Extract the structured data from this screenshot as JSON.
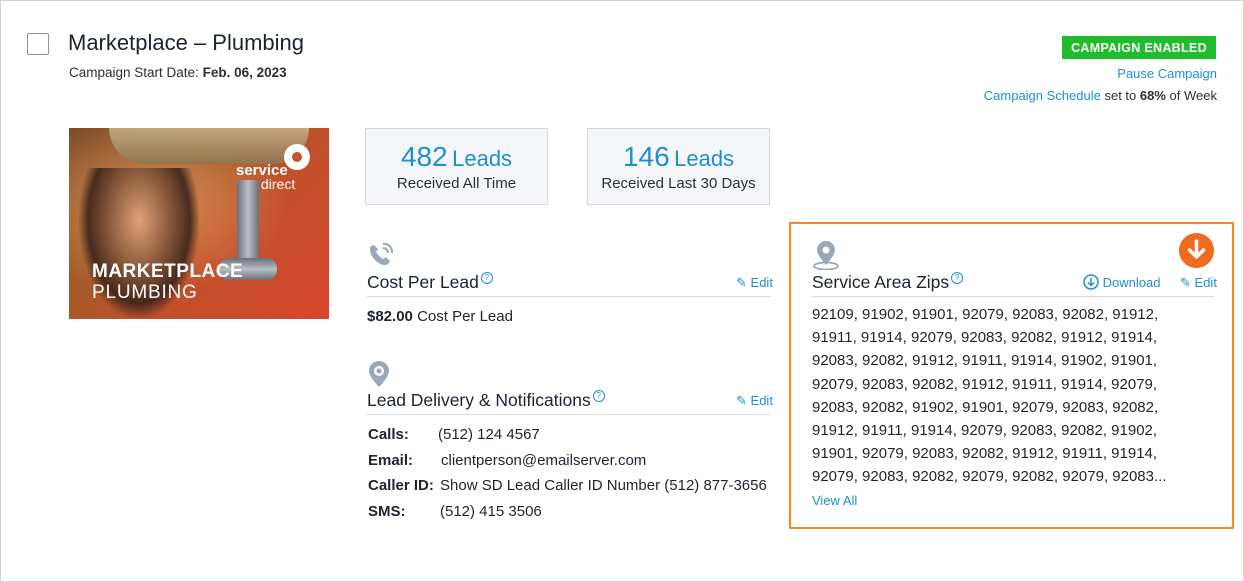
{
  "header": {
    "title": "Marketplace – Plumbing",
    "start_date_label": "Campaign Start Date:",
    "start_date_value": "Feb. 06, 2023",
    "status_badge": "CAMPAIGN ENABLED",
    "pause_link": "Pause Campaign",
    "schedule_link": "Campaign Schedule",
    "schedule_text_1": "set to",
    "schedule_percent": "68%",
    "schedule_text_2": "of Week"
  },
  "promo_image": {
    "brand_line1": "service",
    "brand_line2": "direct",
    "caption_line1": "MARKETPLACE",
    "caption_line2": "PLUMBING"
  },
  "stats": [
    {
      "number": "482",
      "unit": "Leads",
      "label": "Received All Time"
    },
    {
      "number": "146",
      "unit": "Leads",
      "label": "Received Last 30 Days"
    }
  ],
  "cost_per_lead": {
    "heading": "Cost Per Lead",
    "edit_label": "Edit",
    "amount": "$82.00",
    "amount_suffix": "Cost Per Lead",
    "icon": "phone-signal-icon"
  },
  "lead_delivery": {
    "heading": "Lead Delivery & Notifications",
    "edit_label": "Edit",
    "icon": "gear-location-icon",
    "rows": [
      {
        "label": "Calls:",
        "value": "(512) 124 4567"
      },
      {
        "label": "Email:",
        "value": "clientperson@emailserver.com"
      },
      {
        "label": "Caller ID:",
        "value": "Show SD Lead Caller ID Number (512) 877-3656"
      },
      {
        "label": "SMS:",
        "value": "(512) 415 3506"
      }
    ]
  },
  "service_area": {
    "heading": "Service Area Zips",
    "download_label": "Download",
    "edit_label": "Edit",
    "icon": "map-pin-icon",
    "zips_lines": [
      "92109, 91902, 91901, 92079, 92083, 92082, 91912,",
      "91911, 91914, 92079, 92083, 92082, 91912, 91914,",
      "92083, 92082, 91912, 91911, 91914, 91902, 91901,",
      "92079, 92083, 92082, 91912, 91911, 91914, 92079,",
      "92083, 92082, 91902, 91901, 92079, 92083, 92082,",
      "91912, 91911, 91914, 92079, 92083, 92082, 91902,",
      "91901, 92079, 92083, 92082, 91912, 91911, 91914,",
      "92079, 92083, 92082, 92079, 92082, 92079, 92083..."
    ],
    "view_all": "View All"
  },
  "colors": {
    "accent": "#1f8fcf",
    "enabled_green": "#1fbd2c",
    "highlight_orange": "#f28a1d",
    "download_orange": "#f26a1b"
  }
}
